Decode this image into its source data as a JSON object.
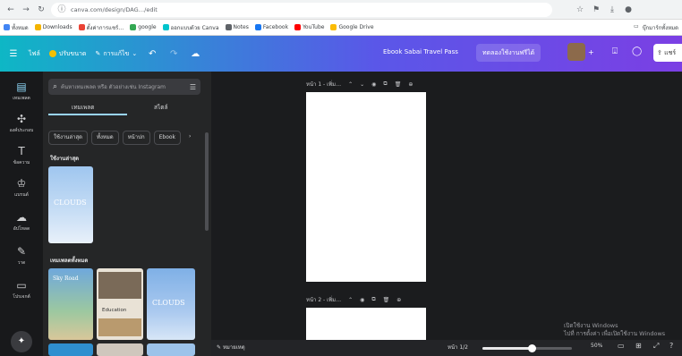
{
  "browser": {
    "url": "canva.com/design/DAG…/edit",
    "bookmarks": [
      "ทั้งหมด",
      "Downloads",
      "ตั้งค่าการแชร์…",
      "google",
      "ออกแบบด้วย Canva",
      "Notes",
      "Facebook",
      "YouTube",
      "Google Drive"
    ],
    "bookmarks_right": "บุ๊กมาร์กทั้งหมด"
  },
  "topbar": {
    "home": "ไฟล์",
    "resize": "ปรับขนาด",
    "editing": "การแก้ไข",
    "doc_title": "Ebook Sabai Travel Pass",
    "cta": "ทดลองใช้งานฟรีได้",
    "share": "แชร์"
  },
  "rail": [
    {
      "icon": "template-icon",
      "glyph": "▤",
      "label": "เทมเพลต",
      "active": true
    },
    {
      "icon": "elements-icon",
      "glyph": "✣",
      "label": "องค์ประกอบ",
      "active": false
    },
    {
      "icon": "text-icon",
      "glyph": "T",
      "label": "ข้อความ",
      "active": false
    },
    {
      "icon": "brand-icon",
      "glyph": "♔",
      "label": "แบรนด์",
      "active": false
    },
    {
      "icon": "uploads-icon",
      "glyph": "☁",
      "label": "อัปโหลด",
      "active": false
    },
    {
      "icon": "draw-icon",
      "glyph": "✎",
      "label": "วาด",
      "active": false
    },
    {
      "icon": "projects-icon",
      "glyph": "▭",
      "label": "โปรเจกต์",
      "active": false
    }
  ],
  "panel": {
    "search_placeholder": "ค้นหาเทมเพลต หรือ ตัวอย่างเช่น Instagram",
    "tabs": [
      "เทมเพลต",
      "สไตล์"
    ],
    "chips": [
      "ใช้งานล่าสุด",
      "ทั้งหมด",
      "หน้าปก",
      "Ebook"
    ],
    "section_recent": "ใช้งานล่าสุด",
    "section_all": "เทมเพลตทั้งหมด",
    "thumbs": {
      "recent": "CLOUDS",
      "t1_title": "Sky Road",
      "t2_title": "Education",
      "t3_title": "CLOUDS"
    }
  },
  "canvas": {
    "page1_label": "หน้า 1 - เพิ่ม…",
    "page2_label": "หน้า 2 - เพิ่ม…"
  },
  "bottom": {
    "notes": "หมายเหตุ",
    "pages": "หน้า 1/2",
    "zoom_label": "50%",
    "zoom_fraction": 0.55
  },
  "watermark": {
    "line1": "เปิดใช้งาน Windows",
    "line2": "ไปที่ การตั้งค่า เพื่อเปิดใช้งาน Windows"
  },
  "colors": {
    "accent": "#8ed8f8",
    "topbar_start": "#0eb7c5",
    "topbar_end": "#7b3fe4"
  }
}
